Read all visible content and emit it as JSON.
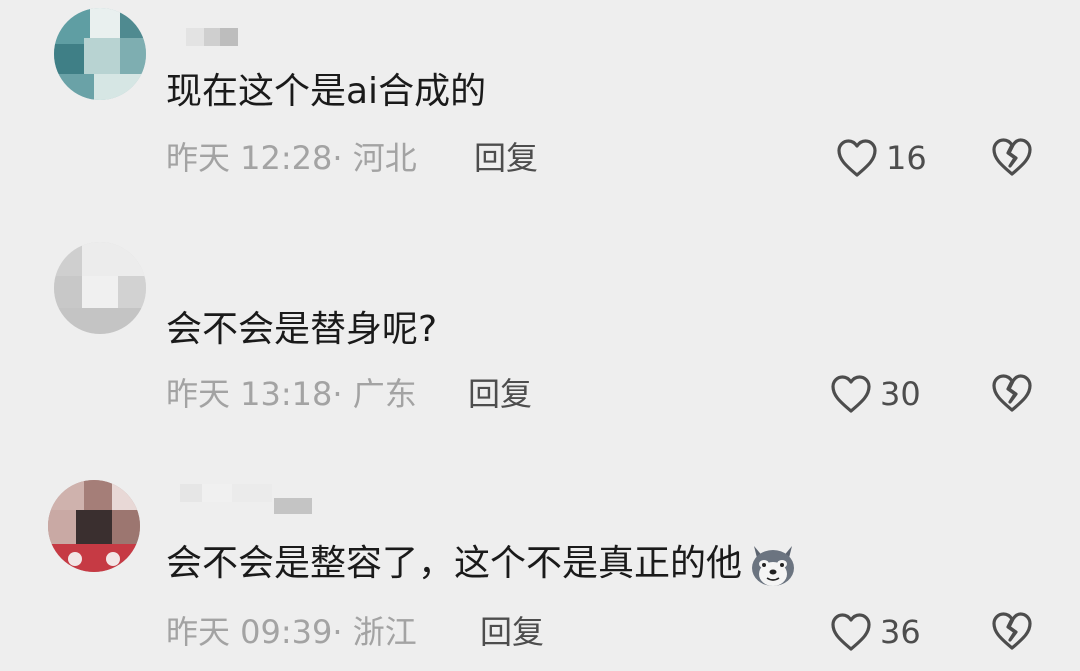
{
  "comments": [
    {
      "text": "现在这个是ai合成的",
      "time": "昨天 12:28",
      "location": "· 河北",
      "reply_label": "回复",
      "likes": "16"
    },
    {
      "text": "会不会是替身呢?",
      "time": "昨天 13:18",
      "location": "· 广东",
      "reply_label": "回复",
      "likes": "30"
    },
    {
      "text": "会不会是整容了，这个不是真正的他",
      "time": "昨天 09:39",
      "location": "· 浙江",
      "reply_label": "回复",
      "likes": "36",
      "emoji": "husky-dog-emoji"
    }
  ],
  "icons": {
    "like": "heart-outline-icon",
    "dislike": "broken-heart-icon"
  },
  "colors": {
    "background": "#eeeeee",
    "text": "#1a1a1a",
    "meta": "#a3a3a3",
    "action": "#4d4d4d"
  }
}
